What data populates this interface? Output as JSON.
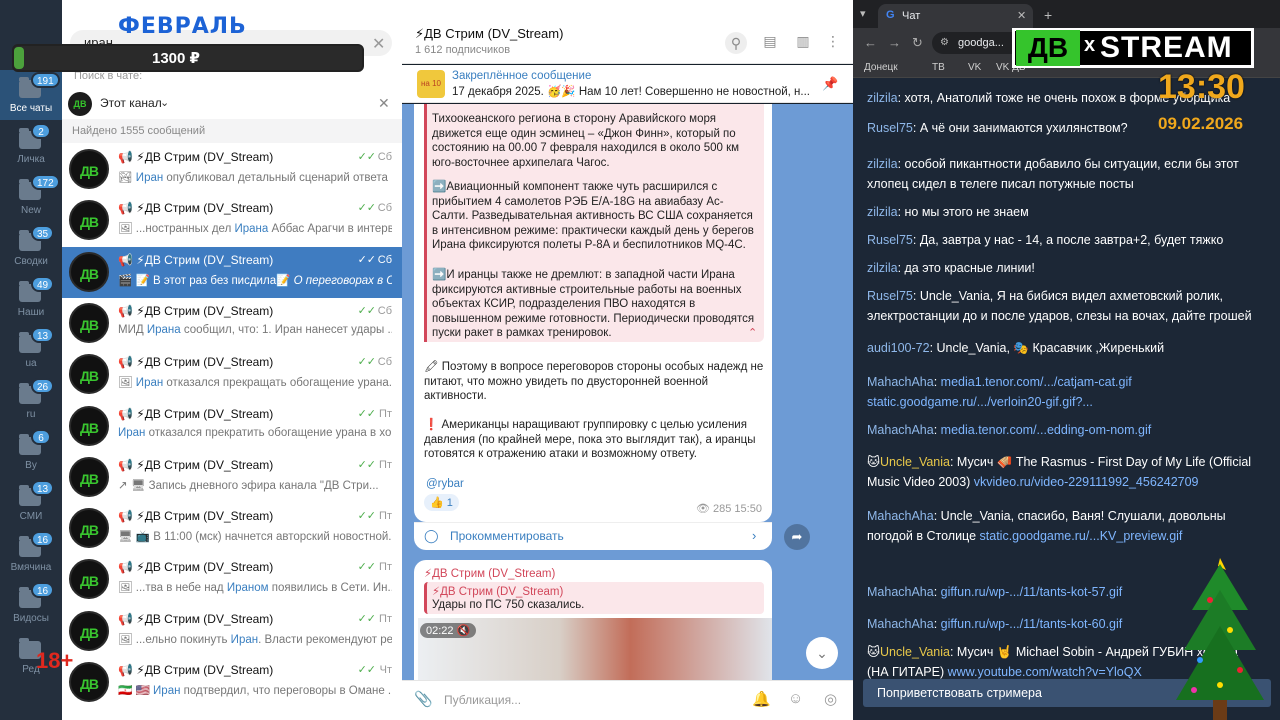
{
  "folders": [
    {
      "label": "Все чаты",
      "badge": "191",
      "active": true
    },
    {
      "label": "Личка",
      "badge": "2"
    },
    {
      "label": "New",
      "badge": "172"
    },
    {
      "label": "Сводки",
      "badge": "35"
    },
    {
      "label": "Наши",
      "badge": "49"
    },
    {
      "label": "ua",
      "badge": "13"
    },
    {
      "label": "ru",
      "badge": "26"
    },
    {
      "label": "By",
      "badge": "6"
    },
    {
      "label": "СМИ",
      "badge": "13"
    },
    {
      "label": "Вмячина",
      "badge": "16"
    },
    {
      "label": "Видосы",
      "badge": "16"
    },
    {
      "label": "Ред"
    }
  ],
  "search": {
    "value": "иран",
    "in_chat_label": "Поиск в чате:",
    "scope": "Этот канал",
    "found": "Найдено 1555 сообщений"
  },
  "results": [
    {
      "avatar": "ДВ",
      "name": "📢 ⚡ДВ Стрим (DV_Stream)",
      "pre": "🏞 ",
      "hl": "Иран",
      "post": " опубликовал детальный сценарий ответа ...",
      "time": "Сб"
    },
    {
      "avatar": "ДВ",
      "name": "📢 ⚡ДВ Стрим (DV_Stream)",
      "pre": "🖼 ...ностранных дел ",
      "hl": "Ирана",
      "post": " Аббас Арагчи в интерв...",
      "time": "Сб"
    },
    {
      "avatar": "ДВ",
      "name": "📢 ⚡ДВ Стрим (DV_Stream)",
      "pre": "🎬 📝 В этот раз без писдила📝 ",
      "hl": "",
      "post": "О переговорах в О...",
      "time": "Сб",
      "active": true
    },
    {
      "avatar": "ДВ",
      "name": "📢 ⚡ДВ Стрим (DV_Stream)",
      "pre": "МИД ",
      "hl": "Ирана",
      "post": " сообщил, что:  1. Иран нанесет удары ...",
      "time": "Сб"
    },
    {
      "avatar": "ДВ",
      "name": "📢 ⚡ДВ Стрим (DV_Stream)",
      "pre": "🖼 ",
      "hl": "Иран",
      "post": " отказался прекращать обогащение урана...",
      "time": "Сб"
    },
    {
      "avatar": "ДВ",
      "name": "📢 ⚡ДВ Стрим (DV_Stream)",
      "pre": "",
      "hl": "Иран",
      "post": " отказался прекратить обогащение урана в хо...",
      "time": "Пт"
    },
    {
      "avatar": "ДВ",
      "name": "📢 ⚡ДВ Стрим (DV_Stream)",
      "pre": "↗ 🖥 Запись дневного эфира канала \"ДВ Стри...",
      "hl": "",
      "post": "",
      "time": "Пт"
    },
    {
      "avatar": "ДВ",
      "name": "📢 ⚡ДВ Стрим (DV_Stream)",
      "pre": "🖥 📺 В 11:00 (мск) начнется авторский новостной...",
      "hl": "",
      "post": "",
      "time": "Пт"
    },
    {
      "avatar": "ДВ",
      "name": "📢 ⚡ДВ Стрим (DV_Stream)",
      "pre": "🖼 ...тва в небе над ",
      "hl": "Ираном",
      "post": " появились в Сети.  Ин...",
      "time": "Пт"
    },
    {
      "avatar": "ДВ",
      "name": "📢 ⚡ДВ Стрим (DV_Stream)",
      "pre": "🖼 ...ельно покинуть ",
      "hl": "Иран",
      "post": ".  Власти рекомендуют ре...",
      "time": "Пт"
    },
    {
      "avatar": "ДВ",
      "name": "📢 ⚡ДВ Стрим (DV_Stream)",
      "pre": "🇮🇷 🇺🇸 ",
      "hl": "Иран",
      "post": " подтвердил, что переговоры в Омане ...",
      "time": "Чт"
    }
  ],
  "channel": {
    "title": "⚡ДВ Стрим (DV_Stream)",
    "subscribers": "1 612 подписчиков",
    "pinned_title": "Закреплённое сообщение",
    "pinned_text": "17 декабря 2025. 🥳🎉 Нам 10 лет! Совершенно не новостной, н...",
    "pinned_thumb": "на 10 лет"
  },
  "post": {
    "quote_p1": "Тихоокеанского региона в сторону Аравийского моря движется еще один эсминец – «Джон Финн», который по состоянию на 00.00 7 февраля находился в около 500 км юго-восточнее архипелага Чагос.",
    "quote_p2": "➡️Авиационный компонент также чуть расширился с прибытием 4 самолетов РЭБ E/A-18G на авиабазу Ас-Салти. Разведывательная активность ВС США сохраняется в интенсивном режиме: практически каждый день у берегов Ирана фиксируются полеты P-8A и беспилотников MQ-4C.",
    "quote_p3": "➡️И иранцы также не дремлют: в западной части Ирана фиксируются активные строительные работы на военных объектах КСИР, подразделения ПВО находятся в повышенном режиме готовности. Периодически проводятся пуски ракет в рамках тренировок.",
    "p4": "🖍 Поэтому в вопросе переговоров стороны особых надежд не питают, что можно увидеть по двусторонней военной активности.",
    "p5": "❗ Американцы наращивают группировку с целью усиления давления (по крайней мере, пока это выглядит так), а иранцы готовятся к отражению атаки и возможному ответу.",
    "signature": "@rybar",
    "reaction": "👍 1",
    "views": "👁 285  15:50",
    "comment_label": "Прокомментировать"
  },
  "post2": {
    "title": "⚡ДВ Стрим (DV_Stream)",
    "quote_name": "⚡ДВ Стрим (DV_Stream)",
    "quote_text": "Удары по ПС 750 сказались.",
    "video_duration": "02:22 🔇"
  },
  "composer_placeholder": "Публикация...",
  "browser": {
    "tab_title": "Чат",
    "address": "goodga...",
    "bookmarks": [
      "Донецк",
      "ТВ",
      "VK",
      "VK ДВ"
    ]
  },
  "chat_messages": [
    {
      "user": "zilzila",
      "text": ": хотя, Анатолий тоже не очень похож в форме уборщика"
    },
    {
      "user": "Rusel75",
      "text": ": А чё они занимаются ухилянством?"
    },
    {
      "user": "zilzila",
      "text": ": особой пикантности добавило бы ситуации, если бы этот хлопец сидел в телеге писал потужные посты"
    },
    {
      "user": "zilzila",
      "text": ": но мы этого не знаем"
    },
    {
      "user": "Rusel75",
      "text": ": Да, завтра у нас - 14, а после завтра+2, будет тяжко"
    },
    {
      "user": "zilzila",
      "text": ": да это красные линии!"
    },
    {
      "user": "Rusel75",
      "text": ": Uncle_Vania, Я на бибися видел ахметовский ролик, электростанции до и после ударов, слезы на вочах, дайте грошей"
    },
    {
      "user": "audi100-72",
      "text": ": Uncle_Vania, 🎭 Красавчик ,Жиренький"
    },
    {
      "user": "MahachAha",
      "text": ": ",
      "link": "media1.tenor.com/.../catjam-cat.gif static.goodgame.ru/.../verloin20-gif.gif?..."
    },
    {
      "user": "MahachAha",
      "text": ": ",
      "link": "media.tenor.com/...edding-om-nom.gif"
    },
    {
      "user": "Uncle_Vania",
      "vip": true,
      "text": ": Мусич 🪗 The Rasmus - First Day of My Life (Official Music Video 2003) ",
      "link": "vkvideo.ru/video-229111992_456242709"
    },
    {
      "user": "MahachAha",
      "text": ": Uncle_Vania, спасибо, Ваня! Слушали, довольны погодой в Столице ",
      "link": "static.goodgame.ru/...KV_preview.gif"
    },
    {
      "user": "MahachAha",
      "text": ": ",
      "link": "giffun.ru/wp-.../11/tants-kot-57.gif"
    },
    {
      "user": "MahachAha",
      "text": ": ",
      "link": "giffun.ru/wp-.../11/tants-kot-60.gif"
    },
    {
      "user": "Uncle_Vania",
      "vip": true,
      "text": ": Мусич 🤘 Michael Sobin - Андрей ГУБИН холода (НА ГИТАРЕ) ",
      "link": "www.youtube.com/watch?v=YloQX"
    }
  ],
  "greet_button": "Поприветствовать стримера",
  "overlay": {
    "month": "ФЕВРАЛЬ",
    "price": "1300 ₽",
    "price_progress": 0.03,
    "age": "18+",
    "logo_dv": "ДВ",
    "logo_x": "x",
    "logo_stream": "STREAM",
    "clock": "13:30",
    "date": "09.02.2026"
  }
}
